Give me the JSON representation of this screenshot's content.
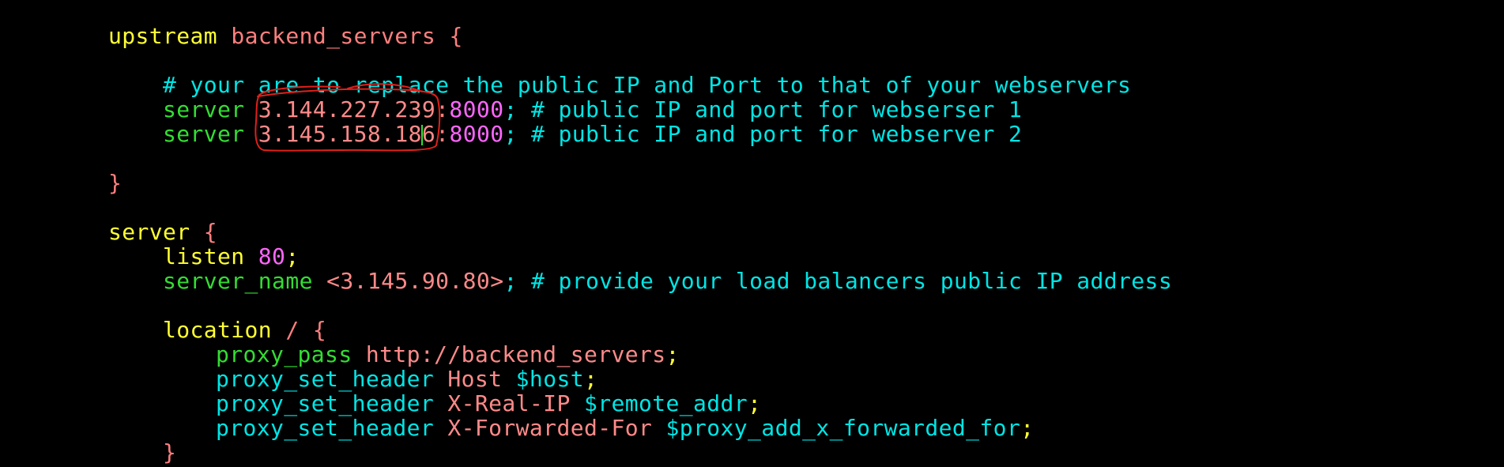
{
  "code": {
    "l1": {
      "kw": "upstream",
      "name": " backend_servers",
      "brace": " {"
    },
    "l3": {
      "comment": "# your are to replace the public IP and Port to that of your webservers"
    },
    "l4": {
      "kw": "server",
      "ip": " 3.144.227.239",
      "colon": ":",
      "port": "8000",
      "semi": ";",
      "comment": " # public IP and port for webserser 1"
    },
    "l5": {
      "kw": "server",
      "ip_a": " 3.145.158.18",
      "ip_b": "6",
      "colon": ":",
      "port": "8000",
      "semi": ";",
      "comment": " # public IP and port for webserver 2"
    },
    "l7": {
      "brace": "}"
    },
    "l9": {
      "kw": "server",
      "brace": " {"
    },
    "l10": {
      "kw": "listen",
      "num": " 80",
      "semi": ";"
    },
    "l11": {
      "kw": "server_name",
      "val": " <3.145.90.80>",
      "semi": ";",
      "comment": " # provide your load balancers public IP address"
    },
    "l13": {
      "kw": "location",
      "path": " / {"
    },
    "l14": {
      "kw": "proxy_pass",
      "val": " http://backend_servers",
      "semi": ";"
    },
    "l15": {
      "kw": "proxy_set_header",
      "name": " Host",
      "var": " $host",
      "semi": ";"
    },
    "l16": {
      "kw": "proxy_set_header",
      "name": " X-Real-IP",
      "var": " $remote_addr",
      "semi": ";"
    },
    "l17": {
      "kw": "proxy_set_header",
      "name": " X-Forwarded-For",
      "var": " $proxy_add_x_forwarded_for",
      "semi": ";"
    },
    "l18": {
      "brace": "}"
    }
  },
  "colors": {
    "background": "#000000",
    "keyword": "#ffff33",
    "brace": "#ff7f7f",
    "directive": "#33dd33",
    "comment": "#00e5e5",
    "number": "#ff66ff",
    "annotation": "#e0201a"
  },
  "icons": {
    "annotation": "red-hand-drawn-circle"
  }
}
